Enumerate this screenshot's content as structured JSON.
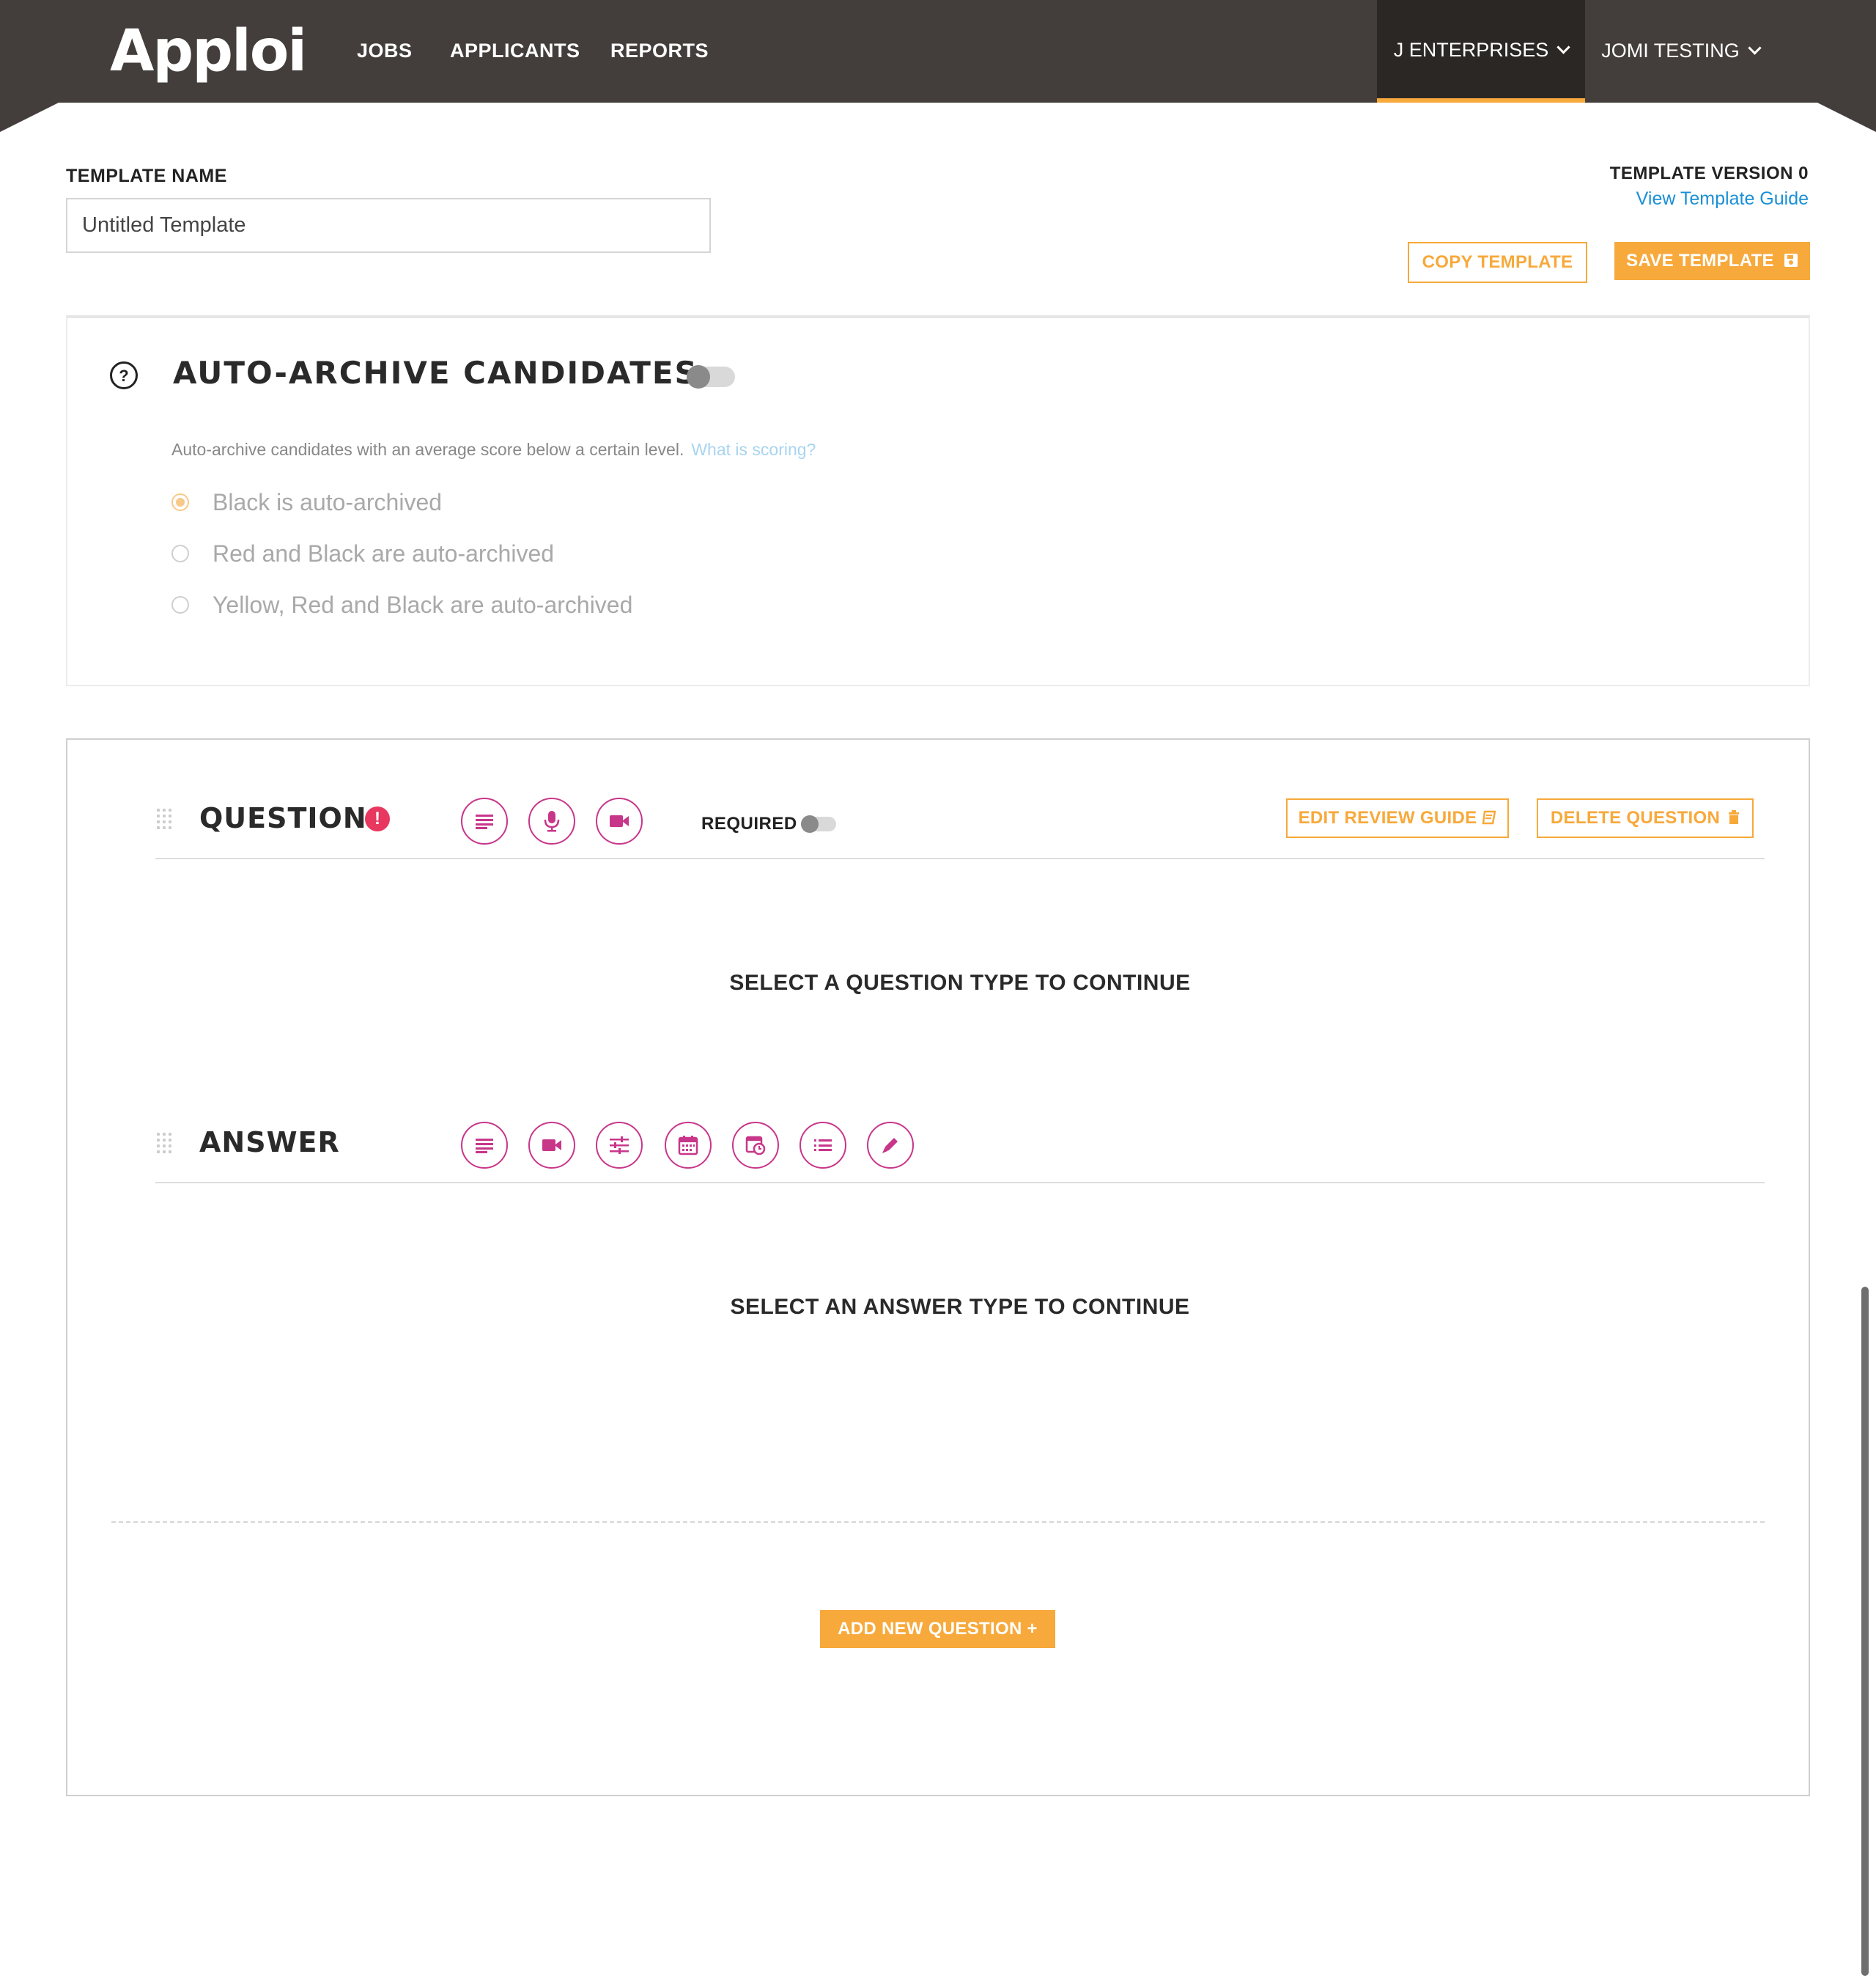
{
  "header": {
    "logo": "Apploi",
    "nav": [
      {
        "label": "JOBS"
      },
      {
        "label": "APPLICANTS"
      },
      {
        "label": "REPORTS"
      }
    ],
    "org_menu": "J ENTERPRISES",
    "user_menu": "JOMI TESTING",
    "colors": {
      "bar": "#433e3b",
      "active_tab": "#2b2725",
      "accent": "#f7a93b"
    }
  },
  "template": {
    "name_label": "TEMPLATE NAME",
    "name_value": "Untitled Template",
    "version_label": "TEMPLATE VERSION 0",
    "guide_link": "View Template Guide",
    "copy_button": "COPY TEMPLATE",
    "save_button": "SAVE TEMPLATE"
  },
  "auto_archive": {
    "title": "AUTO-ARCHIVE CANDIDATES",
    "enabled": false,
    "description": "Auto-archive candidates with an average score below a certain level.",
    "help_link": "What is scoring?",
    "options": [
      {
        "label": "Black is auto-archived",
        "selected": true
      },
      {
        "label": "Red and Black are auto-archived",
        "selected": false
      },
      {
        "label": "Yellow, Red and Black are auto-archived",
        "selected": false
      }
    ]
  },
  "question": {
    "title": "QUESTION",
    "alert_icon": "exclamation-icon",
    "type_icons": [
      "text-lines-icon",
      "microphone-icon",
      "video-camera-icon"
    ],
    "required_label": "REQUIRED",
    "required": false,
    "edit_review_guide": "EDIT REVIEW GUIDE",
    "delete_question": "DELETE QUESTION",
    "placeholder": "SELECT A QUESTION TYPE TO CONTINUE"
  },
  "answer": {
    "title": "ANSWER",
    "type_icons": [
      "text-lines-icon",
      "video-camera-icon",
      "sliders-icon",
      "calendar-icon",
      "schedule-icon",
      "list-icon",
      "pen-icon"
    ],
    "placeholder": "SELECT AN ANSWER TYPE TO CONTINUE"
  },
  "add_question_button": "ADD NEW QUESTION +",
  "accent_color": "#c8368a"
}
